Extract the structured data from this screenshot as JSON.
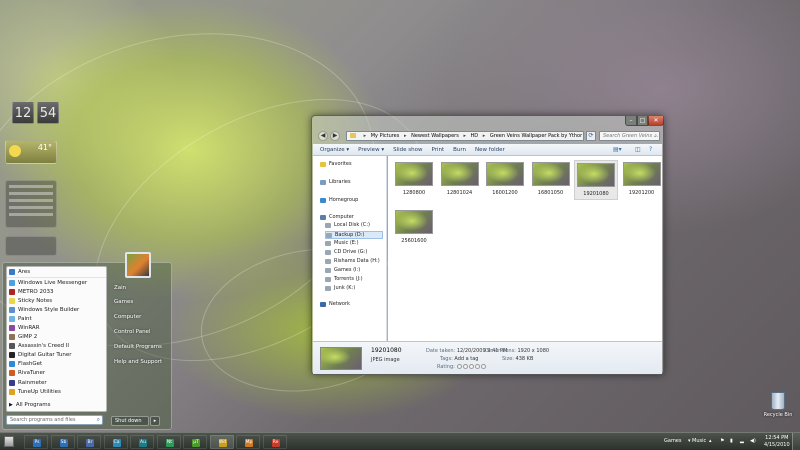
{
  "gadgets": {
    "clock": {
      "hour": "12",
      "minute": "54"
    },
    "weather": {
      "temp": "41°"
    }
  },
  "start_menu": {
    "programs": [
      {
        "label": "Ares",
        "icon": "ares-icon",
        "color": "#3a7bc8"
      },
      {
        "label": "Windows Live Messenger",
        "icon": "messenger-icon",
        "color": "#4aa3df"
      },
      {
        "label": "METRO 2033",
        "icon": "metro-icon",
        "color": "#b22222"
      },
      {
        "label": "Sticky Notes",
        "icon": "sticky-notes-icon",
        "color": "#e8d84a"
      },
      {
        "label": "Windows Style Builder",
        "icon": "style-builder-icon",
        "color": "#5a8fd0"
      },
      {
        "label": "Paint",
        "icon": "paint-icon",
        "color": "#6fb3e0"
      },
      {
        "label": "WinRAR",
        "icon": "winrar-icon",
        "color": "#8a4b9e"
      },
      {
        "label": "GIMP 2",
        "icon": "gimp-icon",
        "color": "#8b7355"
      },
      {
        "label": "Assassin's Creed II",
        "icon": "assassins-creed-icon",
        "color": "#555555"
      },
      {
        "label": "Digital Guitar Tuner",
        "icon": "guitar-tuner-icon",
        "color": "#222222"
      },
      {
        "label": "FlashGet",
        "icon": "flashget-icon",
        "color": "#2d8ad8"
      },
      {
        "label": "RivaTuner",
        "icon": "rivatuner-icon",
        "color": "#d05a20"
      },
      {
        "label": "Rainmeter",
        "icon": "rainmeter-icon",
        "color": "#3a3a8a"
      },
      {
        "label": "TuneUp Utilities",
        "icon": "tuneup-icon",
        "color": "#e0a020"
      }
    ],
    "all_programs": "All Programs",
    "search_placeholder": "Search programs and files",
    "right_items": [
      "Zain",
      "Games",
      "Computer",
      "Control Panel",
      "Default Programs",
      "Help and Support"
    ],
    "shutdown": "Shut down",
    "shutdown_arrow": "▸"
  },
  "explorer": {
    "breadcrumbs": [
      "My Pictures",
      "Newest Wallpapers",
      "HD",
      "Green Veins Wallpaper Pack by Ythor"
    ],
    "search_placeholder": "Search Green Veins ...",
    "toolbar": [
      "Organize ▾",
      "Preview ▾",
      "Slide show",
      "Print",
      "Burn",
      "New folder"
    ],
    "nav": {
      "favorites": "Favorites",
      "libraries": "Libraries",
      "homegroup": "Homegroup",
      "computer": "Computer",
      "drives": [
        "Local Disk (C:)",
        "Backup (D:)",
        "Music (E:)",
        "CD Drive (G:)",
        "Rishams Data (H:)",
        "Games (I:)",
        "Torrents (J:)",
        "Junk (K:)"
      ],
      "selected_drive": "Backup (D:)",
      "network": "Network"
    },
    "files": [
      "1280800",
      "12801024",
      "16001200",
      "16801050",
      "19201080",
      "19201200",
      "25601600"
    ],
    "selected_file": "19201080",
    "details": {
      "name": "19201080",
      "type": "JPEG image",
      "date_label": "Date taken:",
      "date_value": "12/20/2009 9:41 PM",
      "tags_label": "Tags:",
      "tags_value": "Add a tag",
      "rating_label": "Rating:",
      "rating_stars": 0,
      "dimensions_label": "Dimensions:",
      "dimensions_value": "1920 x 1080",
      "size_label": "Size:",
      "size_value": "438 KB"
    }
  },
  "desktop": {
    "recycle_bin": "Recycle Bin"
  },
  "taskbar": {
    "apps": [
      {
        "label": "Ps",
        "color": "#2f6fb5"
      },
      {
        "label": "Sb",
        "color": "#2f6fb5"
      },
      {
        "label": "Br",
        "color": "#4a6aa8"
      },
      {
        "label": "Ca",
        "color": "#2f8ab5"
      },
      {
        "label": "Au",
        "color": "#1e7b8a"
      },
      {
        "label": "Nt",
        "color": "#2f9a5a"
      },
      {
        "label": "µT",
        "color": "#4c9a2a"
      },
      {
        "label": "Wd",
        "color": "#c8a020"
      },
      {
        "label": "Mp",
        "color": "#d07a20"
      },
      {
        "label": "Re",
        "color": "#c83a2a"
      }
    ],
    "tray": {
      "games": "Games",
      "music": "Music"
    },
    "clock_time": "12:54 PM",
    "clock_date": "4/15/2010"
  }
}
